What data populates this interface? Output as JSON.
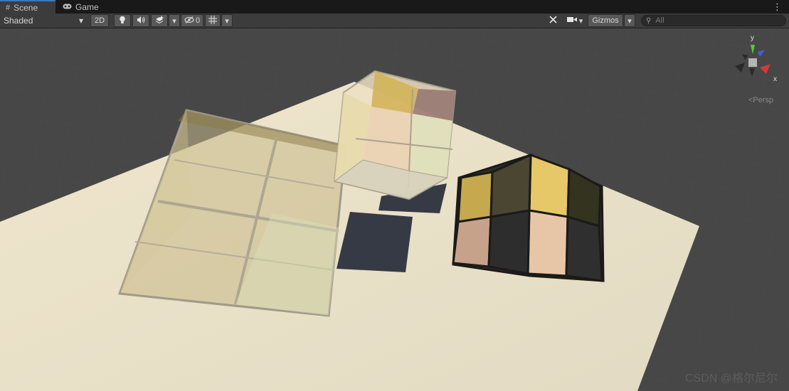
{
  "tabs": [
    {
      "label": "Scene",
      "icon": "grid-icon",
      "active": true
    },
    {
      "label": "Game",
      "icon": "gamepad-icon",
      "active": false
    }
  ],
  "toolbar": {
    "shading_mode": "Shaded",
    "mode_2d": "2D",
    "hidden_count": "0",
    "gizmos_label": "Gizmos",
    "search_placeholder": "All"
  },
  "gizmo": {
    "y_label": "y",
    "x_label": "x",
    "view_mode": "<Persp"
  },
  "watermark": "CSDN @格尔尼尔"
}
